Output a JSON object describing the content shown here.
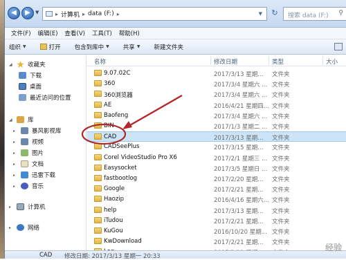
{
  "address": {
    "path": [
      "计算机",
      "data (F:)"
    ],
    "search_placeholder": "搜索 data (F:)"
  },
  "menu": [
    "文件(F)",
    "编辑(E)",
    "查看(V)",
    "工具(T)",
    "帮助(H)"
  ],
  "toolbar": {
    "organize": "组织",
    "open": "打开",
    "include": "包含到库中",
    "share": "共享",
    "new_folder": "新建文件夹"
  },
  "nav": {
    "favorites": "收藏夹",
    "downloads": "下载",
    "desktop": "桌面",
    "recent": "最近访问的位置",
    "libraries": "库",
    "storm": "暴风影视库",
    "videos": "视频",
    "pictures": "图片",
    "documents": "文档",
    "xunlei": "迅雷下载",
    "music": "音乐",
    "computer": "计算机",
    "network": "网络"
  },
  "columns": {
    "name": "名称",
    "date": "修改日期",
    "type": "类型",
    "size": "大小"
  },
  "files": [
    {
      "name": "9.07.02C",
      "date": "2017/3/13 星期...",
      "type": "文件夹"
    },
    {
      "name": "360",
      "date": "2017/3/4 星期六 ...",
      "type": "文件夹"
    },
    {
      "name": "360浏览器",
      "date": "2017/3/4 星期六 ...",
      "type": "文件夹"
    },
    {
      "name": "AE",
      "date": "2016/4/21 星期四...",
      "type": "文件夹"
    },
    {
      "name": "Baofeng",
      "date": "2017/3/4 星期六 ...",
      "type": "文件夹"
    },
    {
      "name": "BIN",
      "date": "2017/1/3 星期二 ...",
      "type": "文件夹"
    },
    {
      "name": "CAD",
      "date": "2017/3/13 星期...",
      "type": "文件夹"
    },
    {
      "name": "CADSeePlus",
      "date": "2017/3/15 星期...",
      "type": "文件夹"
    },
    {
      "name": "Corel VideoStudio Pro X6",
      "date": "2017/2/1 星期三 ...",
      "type": "文件夹"
    },
    {
      "name": "Easysocket",
      "date": "2017/3/5 星期日 ...",
      "type": "文件夹"
    },
    {
      "name": "fastbootlog",
      "date": "2017/2/20 星期...",
      "type": "文件夹"
    },
    {
      "name": "Google",
      "date": "2017/2/21 星期...",
      "type": "文件夹"
    },
    {
      "name": "Haozip",
      "date": "2016/4/16 星期六...",
      "type": "文件夹"
    },
    {
      "name": "help",
      "date": "2017/3/13 星期...",
      "type": "文件夹"
    },
    {
      "name": "iTudou",
      "date": "2017/2/21 星期...",
      "type": "文件夹"
    },
    {
      "name": "KuGou",
      "date": "2016/10/20 星期...",
      "type": "文件夹"
    },
    {
      "name": "KwDownload",
      "date": "2017/2/21 星期...",
      "type": "文件夹"
    },
    {
      "name": "Log",
      "date": "2017/2/21 星期...",
      "type": "文件夹"
    }
  ],
  "selected_index": 6,
  "status": {
    "name": "CAD",
    "detail": "修改日期: 2017/3/13 星期一 20:33"
  },
  "colors": {
    "annotation": "#b0282a",
    "selection": "#cce4f7"
  }
}
